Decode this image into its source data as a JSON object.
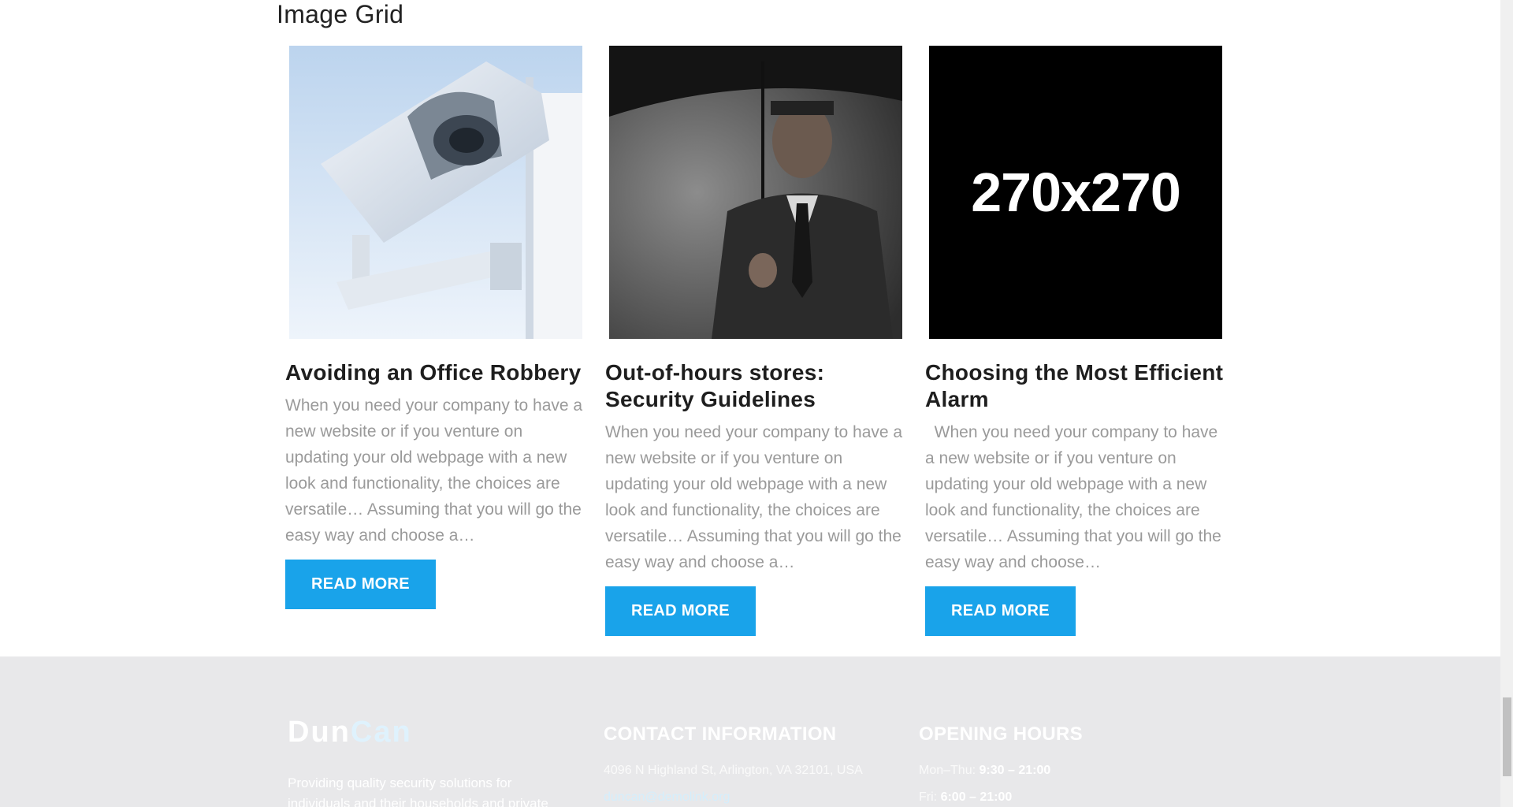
{
  "section": {
    "title": "Image Grid"
  },
  "cards": [
    {
      "image": "security-camera-image",
      "title": "Avoiding an Office Robbery",
      "excerpt": "When you need your company to have a new website or if you venture on updating your old webpage with a new look and functionality, the choices are versatile… Assuming that you will go the easy way and choose a…",
      "button": "READ MORE"
    },
    {
      "image": "man-with-umbrella-image",
      "title": "Out-of-hours stores: Security Guidelines",
      "excerpt": "When you need your company to have a new website or if you venture on updating your old webpage with a new look and functionality, the choices are versatile… Assuming that you will go the easy way and choose a…",
      "button": "READ MORE"
    },
    {
      "image": "placeholder-image",
      "placeholder_text": "270x270",
      "title": "Choosing the Most Efficient Alarm",
      "excerpt": "  When you need your company to have a new website or if you venture on updating your old webpage with a new look and functionality, the choices are versatile… Assuming that you will go the easy way and choose…",
      "button": "READ MORE"
    }
  ],
  "footer": {
    "brand_part1": "Dun",
    "brand_part2": "Can",
    "description": "Providing quality security solutions for individuals and their households and private",
    "contact_heading": "CONTACT INFORMATION",
    "address": "4096 N Highland St, Arlington, VA 32101, USA",
    "email": "duncan@demolink.org",
    "hours_heading": "OPENING HOURS",
    "hours": [
      {
        "days": "Mon–Thu:",
        "time": "9:30 – 21:00"
      },
      {
        "days": "Fri:",
        "time": "6:00 – 21:00"
      }
    ]
  },
  "colors": {
    "accent": "#19a3ea",
    "footer_bg": "#e8e8ea",
    "heading": "#1e1e1e",
    "body_text": "#9a9a9a"
  }
}
